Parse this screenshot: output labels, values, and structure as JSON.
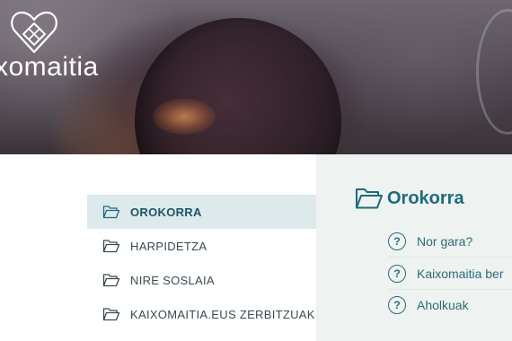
{
  "brand": {
    "logo_text": "xomaitia"
  },
  "nav": {
    "items": [
      {
        "label": "OROKORRA",
        "active": true
      },
      {
        "label": "HARPIDETZA",
        "active": false
      },
      {
        "label": "NIRE SOSLAIA",
        "active": false
      },
      {
        "label": "KAIXOMAITIA.EUS ZERBITZUAK",
        "active": false
      }
    ]
  },
  "panel": {
    "title": "Orokorra",
    "questions": [
      {
        "label": "Nor gara?",
        "icon": "question-icon"
      },
      {
        "label": "Kaixomaitia ber",
        "icon": "question-icon"
      },
      {
        "label": "Aholkuak",
        "icon": "question-icon"
      }
    ]
  },
  "colors": {
    "accent": "#1f6a7c",
    "active_bg": "#dde9ea",
    "panel_bg": "#eef2f1",
    "text": "#3b4a52"
  }
}
